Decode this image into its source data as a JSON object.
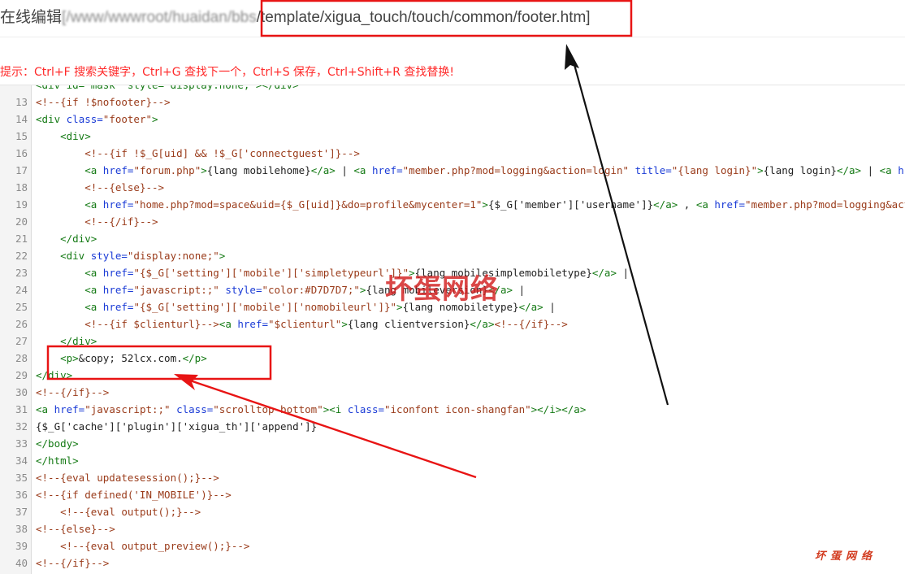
{
  "title": {
    "prefix": "在线编辑",
    "hidden_path": "[/www/wwwroot/huaidan/bbs",
    "file_path": "/template/xigua_touch/touch/common/footer.htm]"
  },
  "hint": "提示：Ctrl+F 搜索关键字，Ctrl+G 查找下一个，Ctrl+S 保存，Ctrl+Shift+R 查找替换!",
  "watermark": {
    "big": "坏蛋网络",
    "small": "坏蛋网络"
  },
  "code_lines": [
    {
      "n": "",
      "indent": "",
      "parts": [
        [
          "t-tag",
          "<div id=\"mask\" style=\"display:none;\"></div>"
        ]
      ]
    },
    {
      "n": "13",
      "indent": "",
      "parts": [
        [
          "t-cmt",
          "<!--{if !$nofooter}-->"
        ]
      ]
    },
    {
      "n": "14",
      "indent": "",
      "parts": [
        [
          "t-tag",
          "<div "
        ],
        [
          "t-attr",
          "class="
        ],
        [
          "t-str",
          "\"footer\""
        ],
        [
          "t-tag",
          ">"
        ]
      ]
    },
    {
      "n": "15",
      "indent": "    ",
      "parts": [
        [
          "t-tag",
          "<div>"
        ]
      ]
    },
    {
      "n": "16",
      "indent": "        ",
      "parts": [
        [
          "t-cmt",
          "<!--{if !$_G[uid] && !$_G['connectguest']}-->"
        ]
      ]
    },
    {
      "n": "17",
      "indent": "        ",
      "parts": [
        [
          "t-tag",
          "<a "
        ],
        [
          "t-attr",
          "href="
        ],
        [
          "t-str",
          "\"forum.php\""
        ],
        [
          "t-tag",
          ">"
        ],
        [
          "t-txt",
          "{lang mobilehome}"
        ],
        [
          "t-tag",
          "</a>"
        ],
        [
          "t-txt",
          " | "
        ],
        [
          "t-tag",
          "<a "
        ],
        [
          "t-attr",
          "href="
        ],
        [
          "t-str",
          "\"member.php?mod=logging&action=login\""
        ],
        [
          "t-attr",
          " title="
        ],
        [
          "t-str",
          "\"{lang login}\""
        ],
        [
          "t-tag",
          ">"
        ],
        [
          "t-txt",
          "{lang login}"
        ],
        [
          "t-tag",
          "</a>"
        ],
        [
          "t-txt",
          " | "
        ],
        [
          "t-tag",
          "<a "
        ],
        [
          "t-attr",
          "hr"
        ]
      ]
    },
    {
      "n": "18",
      "indent": "        ",
      "parts": [
        [
          "t-cmt",
          "<!--{else}-->"
        ]
      ]
    },
    {
      "n": "19",
      "indent": "        ",
      "parts": [
        [
          "t-tag",
          "<a "
        ],
        [
          "t-attr",
          "href="
        ],
        [
          "t-str",
          "\"home.php?mod=space&uid={$_G[uid]}&do=profile&mycenter=1\""
        ],
        [
          "t-tag",
          ">"
        ],
        [
          "t-txt",
          "{$_G['member']['username']}"
        ],
        [
          "t-tag",
          "</a>"
        ],
        [
          "t-txt",
          " , "
        ],
        [
          "t-tag",
          "<a "
        ],
        [
          "t-attr",
          "href="
        ],
        [
          "t-str",
          "\"member.php?mod=logging&act"
        ]
      ]
    },
    {
      "n": "20",
      "indent": "        ",
      "parts": [
        [
          "t-cmt",
          "<!--{/if}-->"
        ]
      ]
    },
    {
      "n": "21",
      "indent": "    ",
      "parts": [
        [
          "t-tag",
          "</div>"
        ]
      ]
    },
    {
      "n": "22",
      "indent": "    ",
      "parts": [
        [
          "t-tag",
          "<div "
        ],
        [
          "t-attr",
          "style="
        ],
        [
          "t-str",
          "\"display:none;\""
        ],
        [
          "t-tag",
          ">"
        ]
      ]
    },
    {
      "n": "23",
      "indent": "        ",
      "parts": [
        [
          "t-tag",
          "<a "
        ],
        [
          "t-attr",
          "href="
        ],
        [
          "t-str",
          "\"{$_G['setting']['mobile']['simpletypeurl']}\""
        ],
        [
          "t-tag",
          ">"
        ],
        [
          "t-txt",
          "{lang mobilesimplemobiletype}"
        ],
        [
          "t-tag",
          "</a>"
        ],
        [
          "t-txt",
          " |"
        ]
      ]
    },
    {
      "n": "24",
      "indent": "        ",
      "parts": [
        [
          "t-tag",
          "<a "
        ],
        [
          "t-attr",
          "href="
        ],
        [
          "t-str",
          "\"javascript:;\""
        ],
        [
          "t-attr",
          " style="
        ],
        [
          "t-str",
          "\"color:#D7D7D7;\""
        ],
        [
          "t-tag",
          ">"
        ],
        [
          "t-txt",
          "{lang mobileversion}"
        ],
        [
          "t-tag",
          "</a>"
        ],
        [
          "t-txt",
          " |"
        ]
      ]
    },
    {
      "n": "25",
      "indent": "        ",
      "parts": [
        [
          "t-tag",
          "<a "
        ],
        [
          "t-attr",
          "href="
        ],
        [
          "t-str",
          "\"{$_G['setting']['mobile']['nomobileurl']}\""
        ],
        [
          "t-tag",
          ">"
        ],
        [
          "t-txt",
          "{lang nomobiletype}"
        ],
        [
          "t-tag",
          "</a>"
        ],
        [
          "t-txt",
          " |"
        ]
      ]
    },
    {
      "n": "26",
      "indent": "        ",
      "parts": [
        [
          "t-cmt",
          "<!--{if $clienturl}-->"
        ],
        [
          "t-tag",
          "<a "
        ],
        [
          "t-attr",
          "href="
        ],
        [
          "t-str",
          "\"$clienturl\""
        ],
        [
          "t-tag",
          ">"
        ],
        [
          "t-txt",
          "{lang clientversion}"
        ],
        [
          "t-tag",
          "</a>"
        ],
        [
          "t-cmt",
          "<!--{/if}-->"
        ]
      ]
    },
    {
      "n": "27",
      "indent": "    ",
      "parts": [
        [
          "t-tag",
          "</div>"
        ]
      ]
    },
    {
      "n": "28",
      "indent": "    ",
      "parts": [
        [
          "t-tag",
          "<p>"
        ],
        [
          "t-txt",
          "&copy; 52lcx.com."
        ],
        [
          "t-tag",
          "</p>"
        ]
      ]
    },
    {
      "n": "29",
      "indent": "",
      "parts": [
        [
          "t-tag",
          "</div>"
        ]
      ]
    },
    {
      "n": "30",
      "indent": "",
      "parts": [
        [
          "t-cmt",
          "<!--{/if}-->"
        ]
      ]
    },
    {
      "n": "31",
      "indent": "",
      "parts": [
        [
          "t-tag",
          "<a "
        ],
        [
          "t-attr",
          "href="
        ],
        [
          "t-str",
          "\"javascript:;\""
        ],
        [
          "t-attr",
          " class="
        ],
        [
          "t-str",
          "\"scrolltop bottom\""
        ],
        [
          "t-tag",
          "><i "
        ],
        [
          "t-attr",
          "class="
        ],
        [
          "t-str",
          "\"iconfont icon-shangfan\""
        ],
        [
          "t-tag",
          "></i></a>"
        ]
      ]
    },
    {
      "n": "32",
      "indent": "",
      "parts": [
        [
          "t-txt",
          "{$_G['cache']['plugin']['xigua_th']['append']}"
        ]
      ]
    },
    {
      "n": "33",
      "indent": "",
      "parts": [
        [
          "t-tag",
          "</body>"
        ]
      ]
    },
    {
      "n": "34",
      "indent": "",
      "parts": [
        [
          "t-tag",
          "</html>"
        ]
      ]
    },
    {
      "n": "35",
      "indent": "",
      "parts": [
        [
          "t-cmt",
          "<!--{eval updatesession();}-->"
        ]
      ]
    },
    {
      "n": "36",
      "indent": "",
      "parts": [
        [
          "t-cmt",
          "<!--{if defined('IN_MOBILE')}-->"
        ]
      ]
    },
    {
      "n": "37",
      "indent": "    ",
      "parts": [
        [
          "t-cmt",
          "<!--{eval output();}-->"
        ]
      ]
    },
    {
      "n": "38",
      "indent": "",
      "parts": [
        [
          "t-cmt",
          "<!--{else}-->"
        ]
      ]
    },
    {
      "n": "39",
      "indent": "    ",
      "parts": [
        [
          "t-cmt",
          "<!--{eval output_preview();}-->"
        ]
      ]
    },
    {
      "n": "40",
      "indent": "",
      "parts": [
        [
          "t-cmt",
          "<!--{/if}-->"
        ]
      ]
    }
  ]
}
